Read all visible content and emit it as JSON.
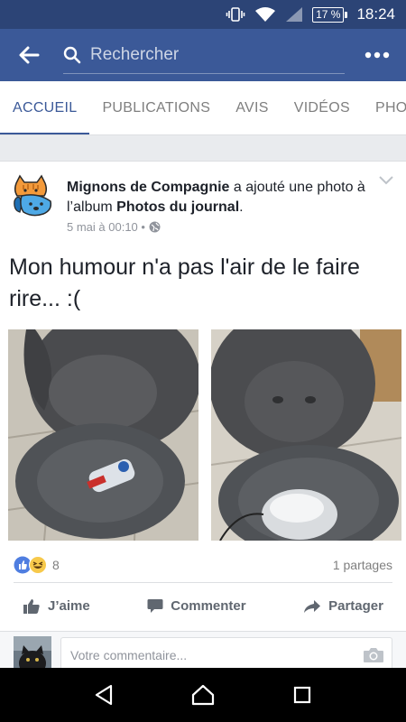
{
  "status_bar": {
    "battery": "17 %",
    "time": "18:24"
  },
  "search": {
    "placeholder": "Rechercher"
  },
  "tabs": [
    {
      "label": "ACCUEIL",
      "active": true
    },
    {
      "label": "PUBLICATIONS"
    },
    {
      "label": "AVIS"
    },
    {
      "label": "VIDÉOS"
    },
    {
      "label": "PHO"
    }
  ],
  "post": {
    "author": "Mignons de Compagnie",
    "action_text": " a ajouté une photo à l’album ",
    "album": "Photos du journal",
    "after_album": ".",
    "timestamp": "5 mai à 00:10 •",
    "text": "Mon humour n'a pas l'air de le faire rire... :(",
    "reaction_count": "8",
    "shares": "1 partages"
  },
  "actions": {
    "like": "J’aime",
    "comment": "Commenter",
    "share": "Partager"
  },
  "comment_box": {
    "placeholder": "Votre commentaire..."
  },
  "colors": {
    "brand": "#3b5998",
    "status_bar": "#2c4476",
    "nav_bar": "#000000"
  }
}
